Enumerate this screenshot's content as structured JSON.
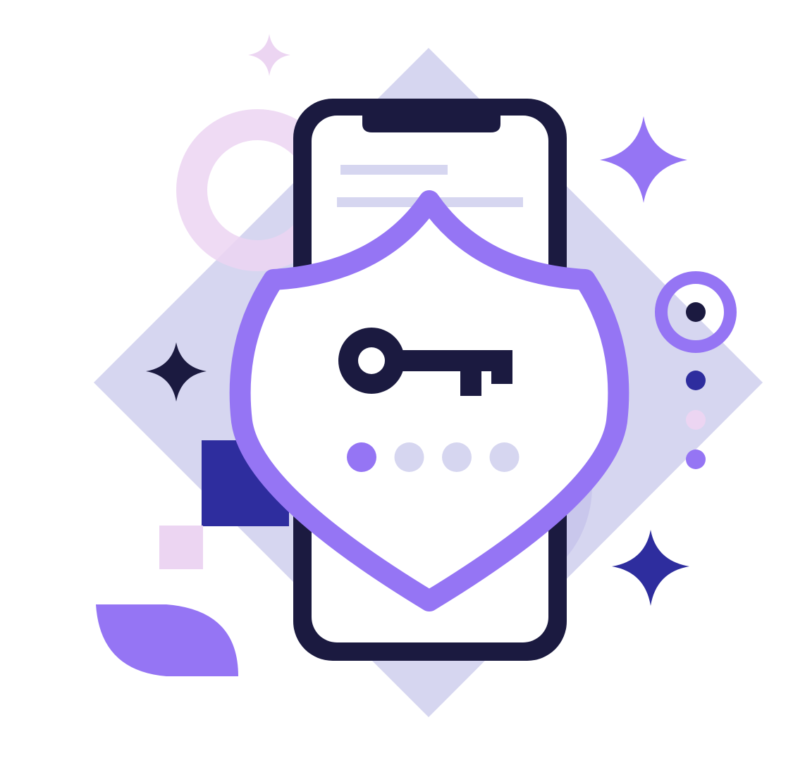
{
  "illustration": {
    "subject": "security-key-on-mobile-phone",
    "icons": [
      "phone-icon",
      "shield-icon",
      "key-icon",
      "sparkle-icon",
      "ring-icon",
      "dot-icon",
      "leaf-icon"
    ],
    "pin": {
      "total_dots": 4,
      "filled_dots": 1
    }
  },
  "colors": {
    "background": "#ffffff",
    "diamond": "#d6d6f0",
    "phone_frame": "#1b1a40",
    "phone_screen": "#ffffff",
    "screen_lines": "#d6d6f0",
    "shield_outline": "#9575f4",
    "shield_fill": "#ffffff",
    "key": "#1b1a40",
    "pin_filled": "#9575f4",
    "pin_empty": "#d6d6f0",
    "pink": "#ecd5f2",
    "purple": "#9575f4",
    "navy": "#2e2d9e",
    "dark": "#1b1a40",
    "lavender_shadow": "#c3c1ea"
  }
}
